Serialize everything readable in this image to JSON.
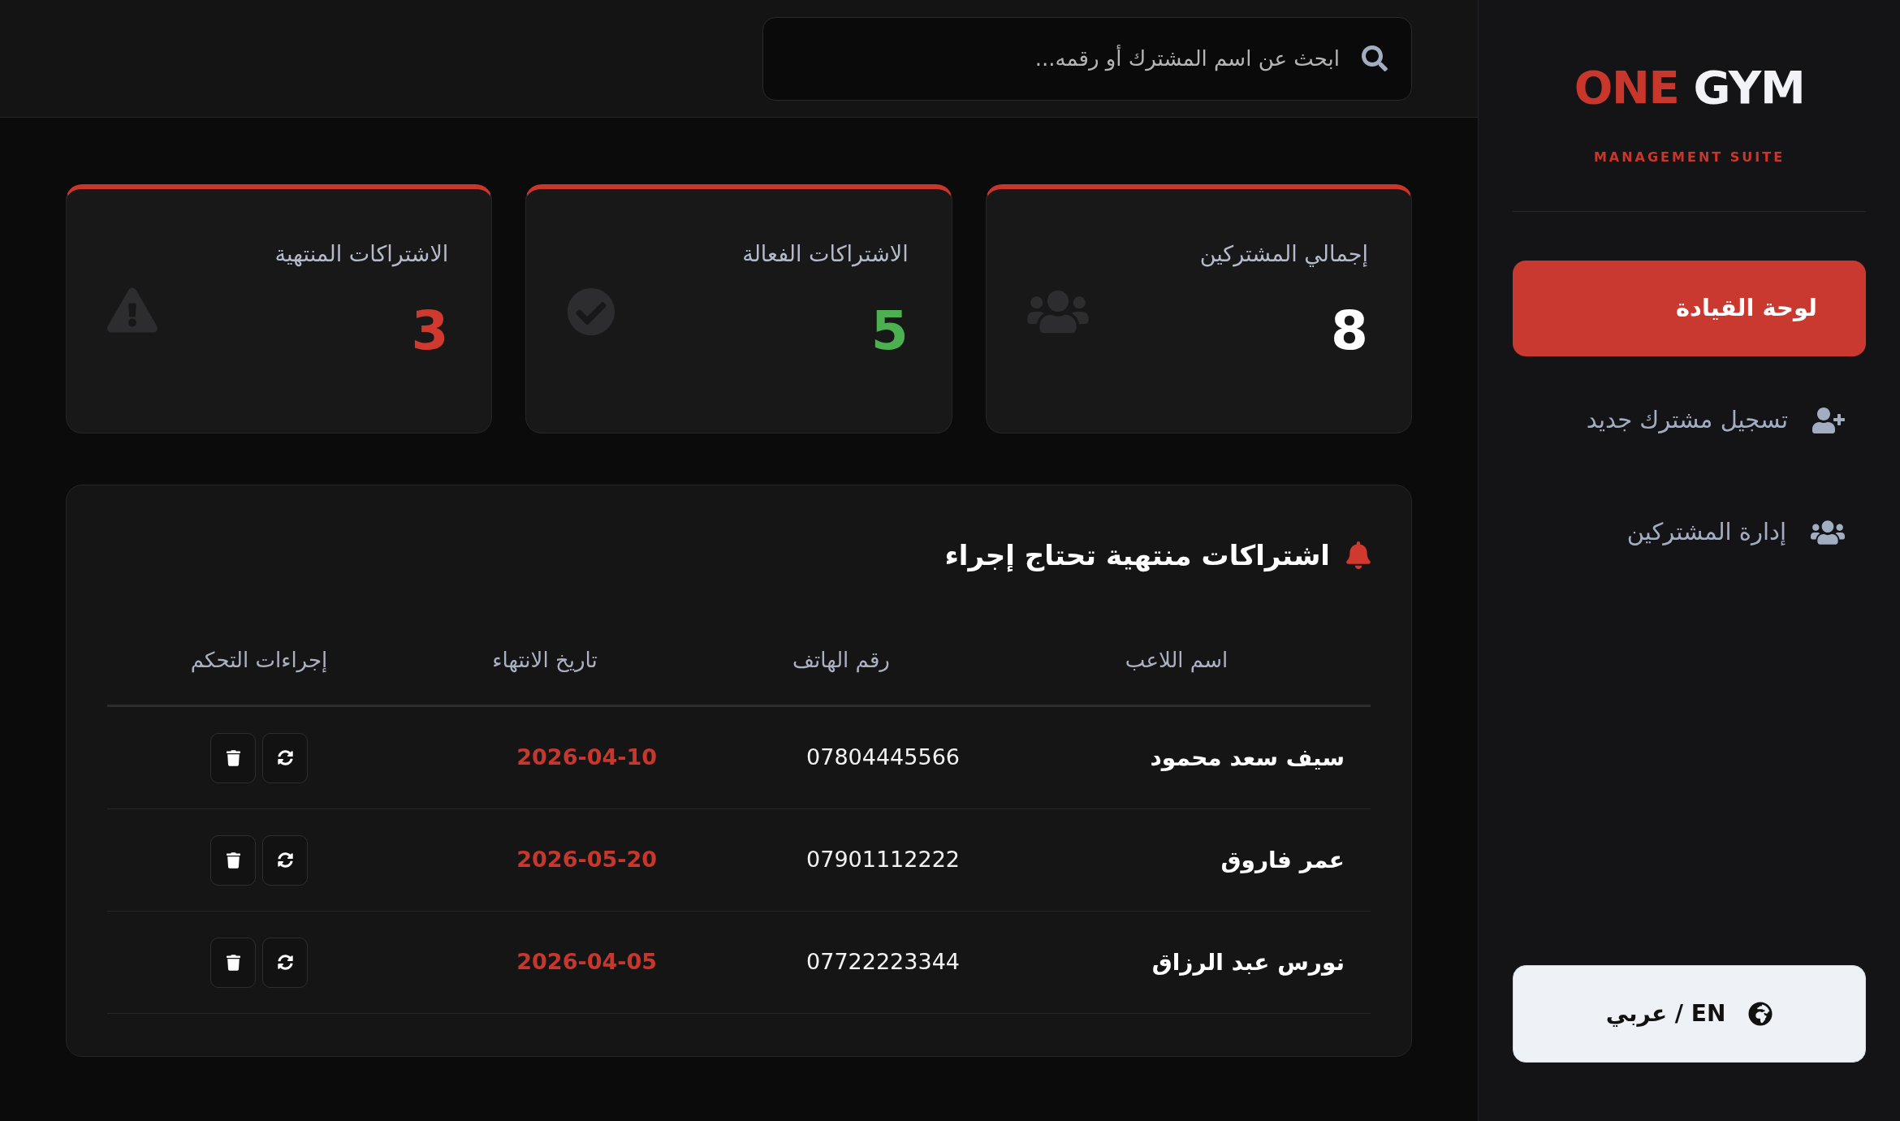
{
  "sidebar": {
    "logo": {
      "accent": "ONE",
      "rest": "GYM"
    },
    "tagline": "MANAGEMENT SUITE",
    "nav_items": [
      {
        "label": "لوحة القيادة",
        "selected": true
      },
      {
        "label": "تسجيل مشترك جديد",
        "selected": false
      },
      {
        "label": "إدارة المشتركين",
        "selected": false
      }
    ],
    "language_button": "عربي / EN"
  },
  "search": {
    "placeholder": "ابحث عن اسم المشترك أو رقمه..."
  },
  "stats": [
    {
      "label": "إجمالي المشتركين",
      "value": "8",
      "color": "#ffffff"
    },
    {
      "label": "الاشتراكات الفعالة",
      "value": "5",
      "color": "#4caf50"
    },
    {
      "label": "الاشتراكات المنتهية",
      "value": "3",
      "color": "#d0392e"
    }
  ],
  "expired_panel": {
    "title": "اشتراكات منتهية تحتاج إجراء",
    "columns": [
      "اسم اللاعب",
      "رقم الهاتف",
      "تاريخ الانتهاء",
      "إجراءات التحكم"
    ],
    "rows": [
      {
        "name": "سيف سعد محمود",
        "phone": "07804445566",
        "end_date": "2026-04-10"
      },
      {
        "name": "عمر فاروق",
        "phone": "07901112222",
        "end_date": "2026-05-20"
      },
      {
        "name": "نورس عبد الرزاق",
        "phone": "07722223344",
        "end_date": "2026-04-05"
      }
    ]
  }
}
